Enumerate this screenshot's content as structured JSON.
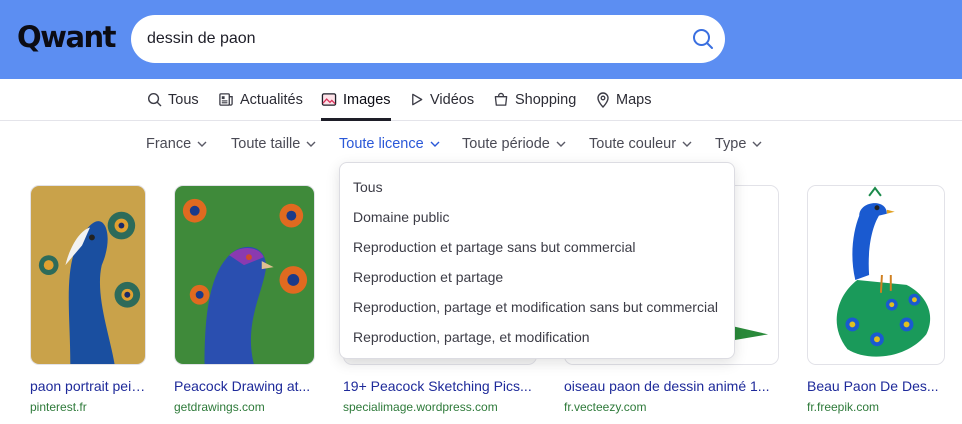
{
  "colors": {
    "header_bg": "#5c8ef2",
    "accent": "#2a58d8",
    "link": "#1e2a9a",
    "source": "#2e7a3a"
  },
  "header": {
    "logo": "Qwant",
    "search_value": "dessin de paon",
    "search_icon": "search-icon"
  },
  "nav": {
    "tabs": [
      {
        "label": "Tous",
        "icon": "search-icon"
      },
      {
        "label": "Actualités",
        "icon": "newspaper-icon"
      },
      {
        "label": "Images",
        "icon": "image-icon",
        "active": true
      },
      {
        "label": "Vidéos",
        "icon": "play-icon"
      },
      {
        "label": "Shopping",
        "icon": "shopping-bag-icon"
      },
      {
        "label": "Maps",
        "icon": "map-pin-icon"
      }
    ]
  },
  "filters": [
    {
      "label": "France"
    },
    {
      "label": "Toute taille"
    },
    {
      "label": "Toute licence",
      "active": true
    },
    {
      "label": "Toute période"
    },
    {
      "label": "Toute couleur"
    },
    {
      "label": "Type"
    }
  ],
  "license_dropdown": {
    "options": [
      "Tous",
      "Domaine public",
      "Reproduction et partage sans but commercial",
      "Reproduction et partage",
      "Reproduction, partage et modification sans but commercial",
      "Reproduction, partage, et modification"
    ]
  },
  "results": [
    {
      "title": "paon portrait peint...",
      "source": "pinterest.fr"
    },
    {
      "title": "Peacock Drawing at...",
      "source": "getdrawings.com"
    },
    {
      "title": "19+ Peacock Sketching Pics...",
      "source": "specialimage.wordpress.com"
    },
    {
      "title": "oiseau paon de dessin animé 1...",
      "source": "fr.vecteezy.com"
    },
    {
      "title": "Beau Paon De Des...",
      "source": "fr.freepik.com"
    }
  ]
}
